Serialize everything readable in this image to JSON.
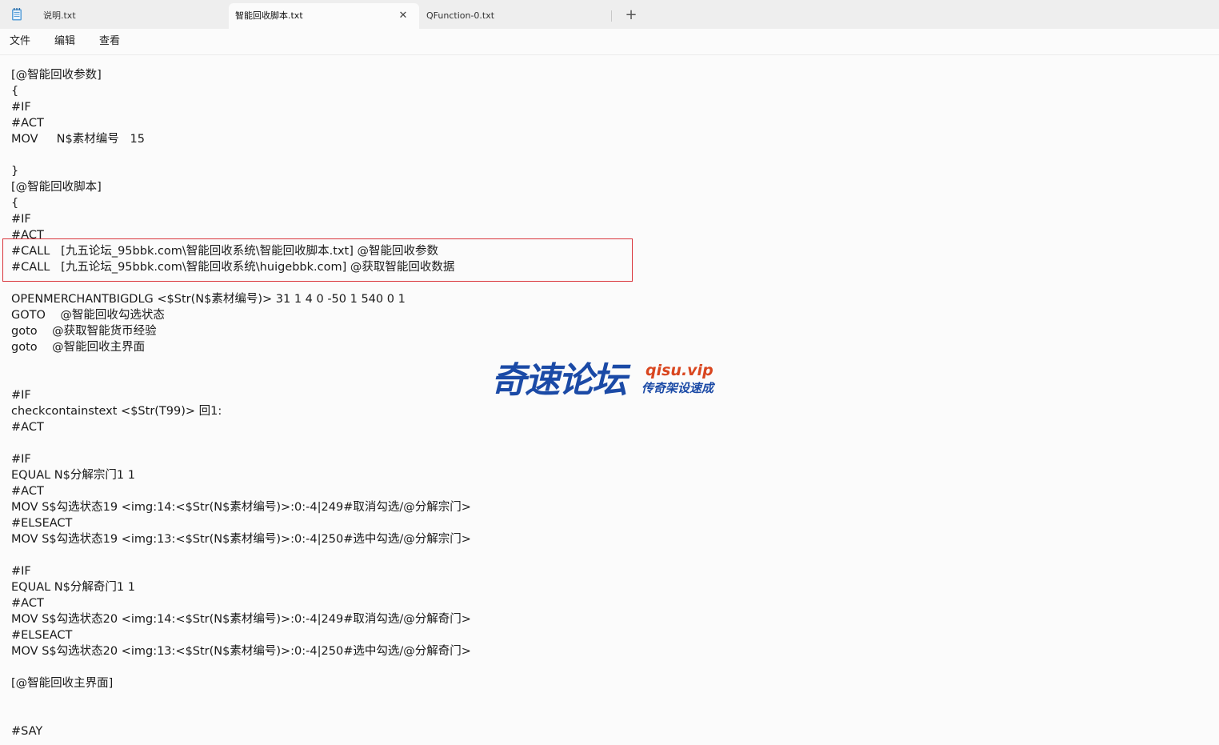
{
  "tabs": [
    {
      "label": "说明.txt"
    },
    {
      "label": "智能回收脚本.txt",
      "close": "✕"
    },
    {
      "label": "QFunction-0.txt"
    }
  ],
  "new_tab": "+",
  "menu": [
    "文件",
    "编辑",
    "查看"
  ],
  "editor_lines": [
    "[@智能回收参数]",
    "{",
    "#IF",
    "#ACT",
    "MOV     N$素材编号   15",
    "",
    "}",
    "[@智能回收脚本]",
    "{",
    "#IF",
    "#ACT",
    "#CALL   [九五论坛_95bbk.com\\智能回收系统\\智能回收脚本.txt] @智能回收参数",
    "#CALL   [九五论坛_95bbk.com\\智能回收系统\\huigebbk.com] @获取智能回收数据",
    "",
    "OPENMERCHANTBIGDLG <$Str(N$素材编号)> 31 1 4 0 -50 1 540 0 1",
    "GOTO    @智能回收勾选状态",
    "goto    @获取智能货币经验",
    "goto    @智能回收主界面",
    "",
    "",
    "#IF",
    "checkcontainstext <$Str(T99)> 回1:",
    "#ACT",
    "",
    "#IF",
    "EQUAL N$分解宗门1 1",
    "#ACT",
    "MOV S$勾选状态19 <img:14:<$Str(N$素材编号)>:0:-4|249#取消勾选/@分解宗门>",
    "#ELSEACT",
    "MOV S$勾选状态19 <img:13:<$Str(N$素材编号)>:0:-4|250#选中勾选/@分解宗门>",
    "",
    "#IF",
    "EQUAL N$分解奇门1 1",
    "#ACT",
    "MOV S$勾选状态20 <img:14:<$Str(N$素材编号)>:0:-4|249#取消勾选/@分解奇门>",
    "#ELSEACT",
    "MOV S$勾选状态20 <img:13:<$Str(N$素材编号)>:0:-4|250#选中勾选/@分解奇门>",
    "",
    "[@智能回收主界面]",
    "",
    "",
    "#SAY"
  ],
  "watermark": {
    "main": "奇速论坛",
    "url": "qisu.vip",
    "sub": "传奇架设速成"
  },
  "colors": {
    "highlight_border": "#d9343b",
    "watermark_blue": "#1b4aa6",
    "watermark_orange": "#d9461f"
  },
  "icons": {
    "app": "notepad-icon",
    "close": "close-icon",
    "new_tab": "plus-icon"
  }
}
